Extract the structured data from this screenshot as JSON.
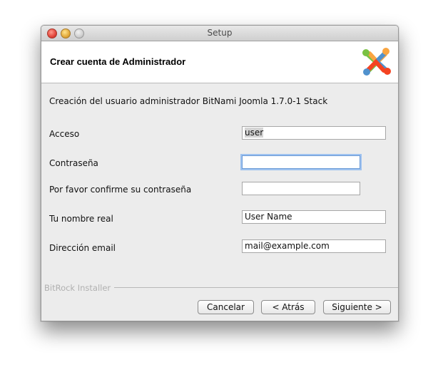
{
  "window": {
    "title": "Setup"
  },
  "header": {
    "title": "Crear cuenta de Administrador",
    "logo": "joomla-logo"
  },
  "intro_text": "Creación del usuario administrador BitNami Joomla 1.7.0-1 Stack",
  "form": {
    "login_label": "Acceso",
    "login_value": "user",
    "password_label": "Contraseña",
    "password_value": "",
    "confirm_label": "Por favor confirme su contraseña",
    "confirm_value": "",
    "realname_label": "Tu nombre real",
    "realname_value": "User Name",
    "email_label": "Dirección email",
    "email_value": "mail@example.com"
  },
  "footer": {
    "installer_label": "BitRock Installer",
    "cancel_label": "Cancelar",
    "back_label": "< Atrás",
    "next_label": "Siguiente >"
  },
  "colors": {
    "focus_ring": "#9ec2f0",
    "window_bg": "#ececec",
    "logo_green": "#7ac143",
    "logo_orange": "#f9a541",
    "logo_blue": "#5091cd",
    "logo_red": "#f44321"
  }
}
